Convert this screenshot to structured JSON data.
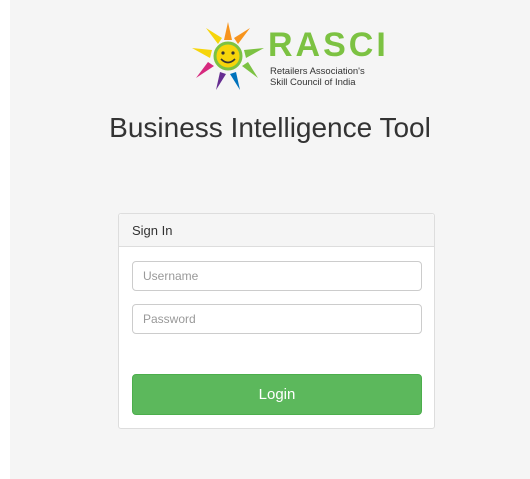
{
  "brand": {
    "name": "RASCI",
    "subtitle_line1": "Retailers Association's",
    "subtitle_line2": "Skill Council of India",
    "colors": {
      "green": "#7cc242",
      "orange": "#f7941d",
      "yellow": "#f6d50b",
      "magenta": "#d6297e",
      "purple": "#662d91",
      "blue": "#0072bc"
    }
  },
  "app_title": "Business Intelligence Tool",
  "login_panel": {
    "heading": "Sign In",
    "username": {
      "value": "",
      "placeholder": "Username"
    },
    "password": {
      "value": "",
      "placeholder": "Password"
    },
    "login_label": "Login",
    "button_color": "#5cb85c"
  }
}
